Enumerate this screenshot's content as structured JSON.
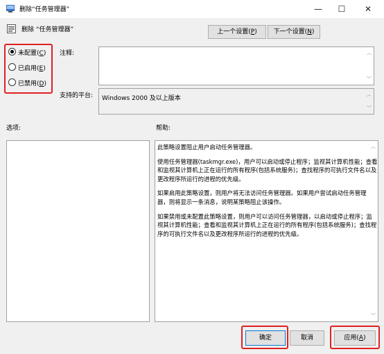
{
  "window": {
    "title": "删除“任务管理器”",
    "minimize": "—",
    "maximize": "☐",
    "close": "✕"
  },
  "header": {
    "title": "删除 “任务管理器”",
    "prev_label": "上一个设置(",
    "prev_key": "P",
    "next_label": "下一个设置(",
    "next_key": "N",
    "close_paren": ")"
  },
  "state_options": [
    {
      "label": "未配置(",
      "key": "C",
      "checked": true
    },
    {
      "label": "已启用(",
      "key": "E",
      "checked": false
    },
    {
      "label": "已禁用(",
      "key": "D",
      "checked": false
    }
  ],
  "fields": {
    "comment_label": "注释:",
    "platform_label": "支持的平台:",
    "platform_value": "Windows 2000 及以上版本",
    "options_label": "选项:",
    "help_label": "帮助:"
  },
  "help": {
    "paragraphs": [
      "此策略设置阻止用户启动任务管理器。",
      "使用任务管理器(taskmgr.exe)，用户可以启动或停止程序；监视其计算机性能；查看和监视其计算机上正在运行的所有程序(包括系统服务)；查找程序的可执行文件名以及更改程序所运行的进程的优先级。",
      "如果启用此策略设置，则用户将无法访问任务管理器。如果用户尝试启动任务管理器，则将显示一条消息，说明某策略阻止该操作。",
      "如果禁用或未配置此策略设置，则用户可以访问任务管理器，以启动或停止程序；监视其计算机性能；查看和监视其计算机上正在运行的所有程序(包括系统服务)；查找程序的可执行文件名以及更改程序所运行的进程的优先级。"
    ]
  },
  "footer": {
    "ok": "确定",
    "cancel": "取消",
    "apply_label": "应用(",
    "apply_key": "A",
    "close_paren": ")"
  },
  "colors": {
    "highlight": "#e02020",
    "dialog_bg": "#f0f0f0",
    "button_bg": "#e1e1e1"
  }
}
